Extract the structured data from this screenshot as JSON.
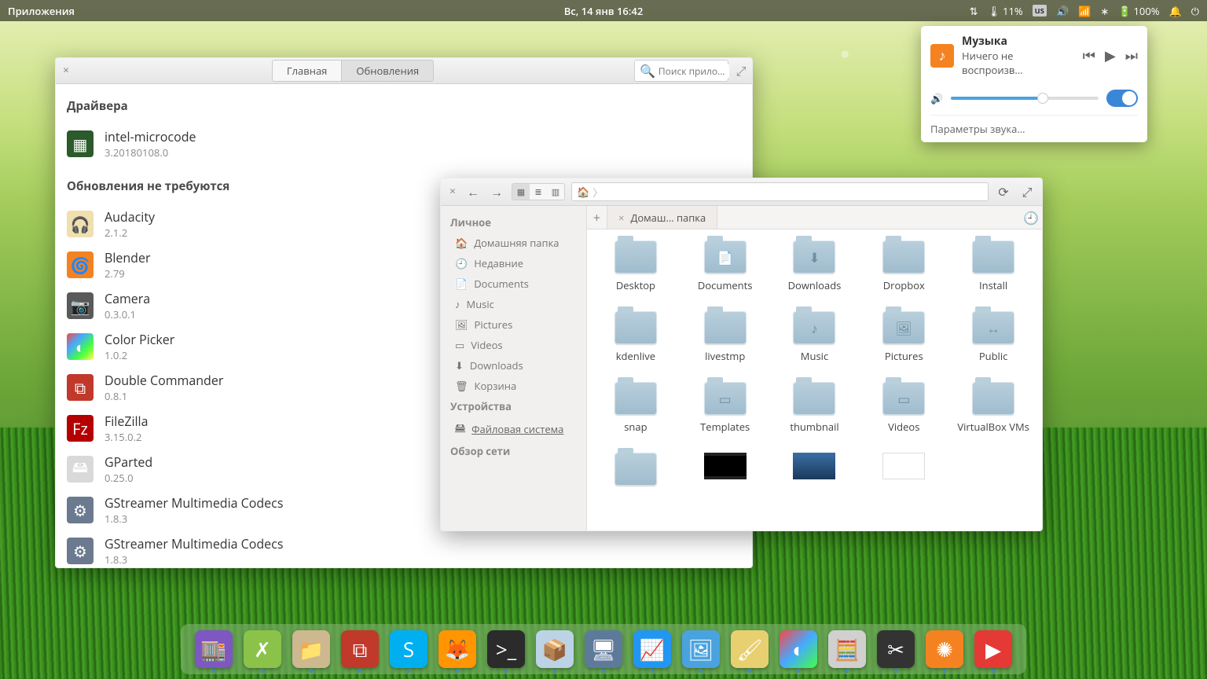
{
  "topbar": {
    "apps_label": "Приложения",
    "datetime": "Вс, 14 янв   16:42",
    "cpu_temp": "11%",
    "kb_layout": "us",
    "battery": "100%"
  },
  "sound_popover": {
    "title": "Музыка",
    "subtitle": "Ничего не воспроизв…",
    "settings_label": "Параметры звука…"
  },
  "appcenter": {
    "tabs": {
      "home": "Главная",
      "updates": "Обновления"
    },
    "search_placeholder": "Поиск прило…",
    "section_drivers": "Драйвера",
    "driver": {
      "name": "intel-microcode",
      "version": "3.20180108.0"
    },
    "section_uptodate": "Обновления не требуются",
    "apps": [
      {
        "name": "Audacity",
        "version": "2.1.2",
        "bg": "#f0e0b0",
        "glyph": "🎧"
      },
      {
        "name": "Blender",
        "version": "2.79",
        "bg": "#f58220",
        "glyph": "🌀"
      },
      {
        "name": "Camera",
        "version": "0.3.0.1",
        "bg": "#5a5a5a",
        "glyph": "📷"
      },
      {
        "name": "Color Picker",
        "version": "1.0.2",
        "bg": "linear-gradient(135deg,#f44,#4af,#4f4,#ff4)",
        "glyph": "◐"
      },
      {
        "name": "Double Commander",
        "version": "0.8.1",
        "bg": "#c0392b",
        "glyph": "⧉"
      },
      {
        "name": "FileZilla",
        "version": "3.15.0.2",
        "bg": "#b40000",
        "glyph": "Fz"
      },
      {
        "name": "GParted",
        "version": "0.25.0",
        "bg": "#d9d9d9",
        "glyph": "🖴"
      },
      {
        "name": "GStreamer Multimedia Codecs",
        "version": "1.8.3",
        "bg": "#6b7a8f",
        "glyph": "⚙"
      },
      {
        "name": "GStreamer Multimedia Codecs",
        "version": "1.8.3",
        "bg": "#6b7a8f",
        "glyph": "⚙"
      }
    ]
  },
  "files": {
    "sidebar": {
      "personal": "Личное",
      "items": [
        {
          "label": "Домашняя папка",
          "icon": "🏠"
        },
        {
          "label": "Недавние",
          "icon": "🕘"
        },
        {
          "label": "Documents",
          "icon": "📄"
        },
        {
          "label": "Music",
          "icon": "♪"
        },
        {
          "label": "Pictures",
          "icon": "🖼"
        },
        {
          "label": "Videos",
          "icon": "▭"
        },
        {
          "label": "Downloads",
          "icon": "⬇"
        },
        {
          "label": "Корзина",
          "icon": "🗑"
        }
      ],
      "devices": "Устройства",
      "device_item": "Файловая система",
      "network": "Обзор сети"
    },
    "tab_label": "Домаш… папка",
    "folders": [
      {
        "name": "Desktop",
        "glyph": ""
      },
      {
        "name": "Documents",
        "glyph": "📄"
      },
      {
        "name": "Downloads",
        "glyph": "⬇"
      },
      {
        "name": "Dropbox",
        "glyph": ""
      },
      {
        "name": "Install",
        "glyph": ""
      },
      {
        "name": "kdenlive",
        "glyph": ""
      },
      {
        "name": "livestmp",
        "glyph": ""
      },
      {
        "name": "Music",
        "glyph": "♪"
      },
      {
        "name": "Pictures",
        "glyph": "🖼"
      },
      {
        "name": "Public",
        "glyph": "↔"
      },
      {
        "name": "snap",
        "glyph": ""
      },
      {
        "name": "Templates",
        "glyph": "▭"
      },
      {
        "name": "thumbnail",
        "glyph": ""
      },
      {
        "name": "Videos",
        "glyph": "▭"
      },
      {
        "name": "VirtualBox VMs",
        "glyph": ""
      }
    ],
    "extras": [
      {
        "type": "folder",
        "name": ""
      },
      {
        "type": "video",
        "name": ""
      },
      {
        "type": "image",
        "name": ""
      },
      {
        "type": "text",
        "name": ""
      }
    ]
  },
  "dock": [
    {
      "bg": "#7e57c2",
      "glyph": "🏬"
    },
    {
      "bg": "#8bc34a",
      "glyph": "✗"
    },
    {
      "bg": "#cdb890",
      "glyph": "📁"
    },
    {
      "bg": "#c0392b",
      "glyph": "⧉"
    },
    {
      "bg": "#00aff0",
      "glyph": "S"
    },
    {
      "bg": "#ff9500",
      "glyph": "🦊"
    },
    {
      "bg": "#2b2b2b",
      "glyph": ">_"
    },
    {
      "bg": "#bcd3e6",
      "glyph": "📦"
    },
    {
      "bg": "#5e7a9b",
      "glyph": "🖥"
    },
    {
      "bg": "#2196f3",
      "glyph": "📈"
    },
    {
      "bg": "#4aa3df",
      "glyph": "🖼"
    },
    {
      "bg": "#e8d070",
      "glyph": "🖌"
    },
    {
      "bg": "linear-gradient(135deg,#f44,#4af,#4f4)",
      "glyph": "◐"
    },
    {
      "bg": "#d0d0d0",
      "glyph": "🧮"
    },
    {
      "bg": "#333",
      "glyph": "✂"
    },
    {
      "bg": "#f58220",
      "glyph": "✺"
    },
    {
      "bg": "#e53935",
      "glyph": "▶"
    }
  ]
}
